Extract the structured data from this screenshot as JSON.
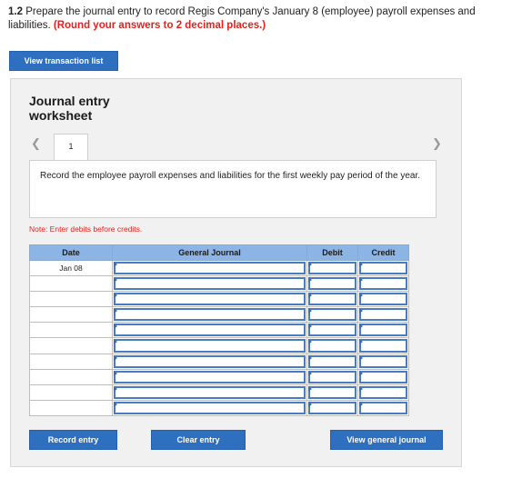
{
  "question": {
    "number": "1.2",
    "text": "Prepare the journal entry to record Regis Company's January 8 (employee) payroll expenses and liabilities.",
    "instruction": "(Round your answers to 2 decimal places.)"
  },
  "buttons": {
    "view_transaction_list": "View transaction list",
    "record_entry": "Record entry",
    "clear_entry": "Clear entry",
    "view_general_journal": "View general journal"
  },
  "worksheet": {
    "title_line1": "Journal entry",
    "title_line2": "worksheet",
    "tab_label": "1",
    "prev_icon": "chevron-left-icon",
    "next_icon": "chevron-right-icon",
    "description": "Record the employee payroll expenses and liabilities for the first weekly pay period of the year.",
    "note": "Note: Enter debits before credits."
  },
  "journal": {
    "headers": [
      "Date",
      "General Journal",
      "Debit",
      "Credit"
    ],
    "rows": [
      {
        "date": "Jan 08"
      },
      {
        "date": ""
      },
      {
        "date": ""
      },
      {
        "date": ""
      },
      {
        "date": ""
      },
      {
        "date": ""
      },
      {
        "date": ""
      },
      {
        "date": ""
      },
      {
        "date": ""
      },
      {
        "date": ""
      }
    ]
  }
}
